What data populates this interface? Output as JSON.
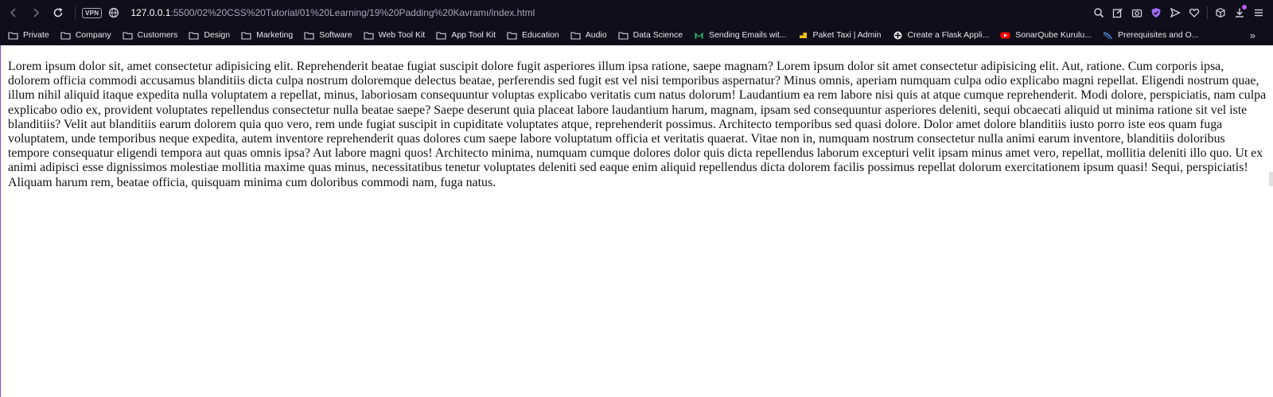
{
  "browser": {
    "nav": {
      "back": "back-icon",
      "forward": "forward-icon",
      "reload": "reload-icon"
    },
    "vpn_label": "VPN",
    "url_host": "127.0.0.1",
    "url_rest": ":5500/02%20CSS%20Tutorial/01%20Learning/19%20Padding%20Kavramı/index.html",
    "right_icons": [
      "zoom-icon",
      "edit-icon",
      "camera-icon",
      "shield-icon",
      "send-icon",
      "heart-icon",
      "cube-icon",
      "download-icon",
      "menu-icon"
    ],
    "accent_color": "#b45cf0"
  },
  "bookmarks": [
    {
      "label": "Private",
      "icon": "folder-icon"
    },
    {
      "label": "Company",
      "icon": "folder-icon"
    },
    {
      "label": "Customers",
      "icon": "folder-icon"
    },
    {
      "label": "Design",
      "icon": "folder-icon"
    },
    {
      "label": "Marketing",
      "icon": "folder-icon"
    },
    {
      "label": "Software",
      "icon": "folder-icon"
    },
    {
      "label": "Web Tool Kit",
      "icon": "folder-icon"
    },
    {
      "label": "App Tool Kit",
      "icon": "folder-icon"
    },
    {
      "label": "Education",
      "icon": "folder-icon"
    },
    {
      "label": "Audio",
      "icon": "folder-icon"
    },
    {
      "label": "Data Science",
      "icon": "folder-icon"
    },
    {
      "label": "Sending Emails wit...",
      "icon": "mail-logo-icon"
    },
    {
      "label": "Paket Taxi | Admin",
      "icon": "taxi-logo-icon"
    },
    {
      "label": "Create a Flask Appli...",
      "icon": "flask-logo-icon"
    },
    {
      "label": "SonarQube Kurulu...",
      "icon": "youtube-icon"
    },
    {
      "label": "Prerequisites and O...",
      "icon": "sonar-logo-icon"
    }
  ],
  "bookmarks_more": "»",
  "page": {
    "paragraph": "Lorem ipsum dolor sit, amet consectetur adipisicing elit. Reprehenderit beatae fugiat suscipit dolore fugit asperiores illum ipsa ratione, saepe magnam? Lorem ipsum dolor sit amet consectetur adipisicing elit. Aut, ratione. Cum corporis ipsa, dolorem officia commodi accusamus blanditiis dicta culpa nostrum doloremque delectus beatae, perferendis sed fugit est vel nisi temporibus aspernatur? Minus omnis, aperiam numquam culpa odio explicabo magni repellat. Eligendi nostrum quae, illum nihil aliquid itaque expedita nulla voluptatem a repellat, minus, laboriosam consequuntur voluptas explicabo veritatis cum natus dolorum! Laudantium ea rem labore nisi quis at atque cumque reprehenderit. Modi dolore, perspiciatis, nam culpa explicabo odio ex, provident voluptates repellendus consectetur nulla beatae saepe? Saepe deserunt quia placeat labore laudantium harum, magnam, ipsam sed consequuntur asperiores deleniti, sequi obcaecati aliquid ut minima ratione sit vel iste blanditiis? Velit aut blanditiis earum dolorem quia quo vero, rem unde fugiat suscipit in cupiditate voluptates atque, reprehenderit possimus. Architecto temporibus sed quasi dolore. Dolor amet dolore blanditiis iusto porro iste eos quam fuga voluptatem, unde temporibus neque expedita, autem inventore reprehenderit quas dolores cum saepe labore voluptatum officia et veritatis quaerat. Vitae non in, numquam nostrum consectetur nulla animi earum inventore, blanditiis doloribus tempore consequatur eligendi tempora aut quas omnis ipsa? Aut labore magni quos! Architecto minima, numquam cumque dolores dolor quis dicta repellendus laborum excepturi velit ipsam minus amet vero, repellat, mollitia deleniti illo quo. Ut ex animi adipisci esse dignissimos molestiae mollitia maxime quas minus, necessitatibus tenetur voluptates deleniti sed eaque enim aliquid repellendus dicta dolorem facilis possimus repellat dolorum exercitationem ipsum quasi! Sequi, perspiciatis! Aliquam harum rem, beatae officia, quisquam minima cum doloribus commodi nam, fuga natus."
  }
}
